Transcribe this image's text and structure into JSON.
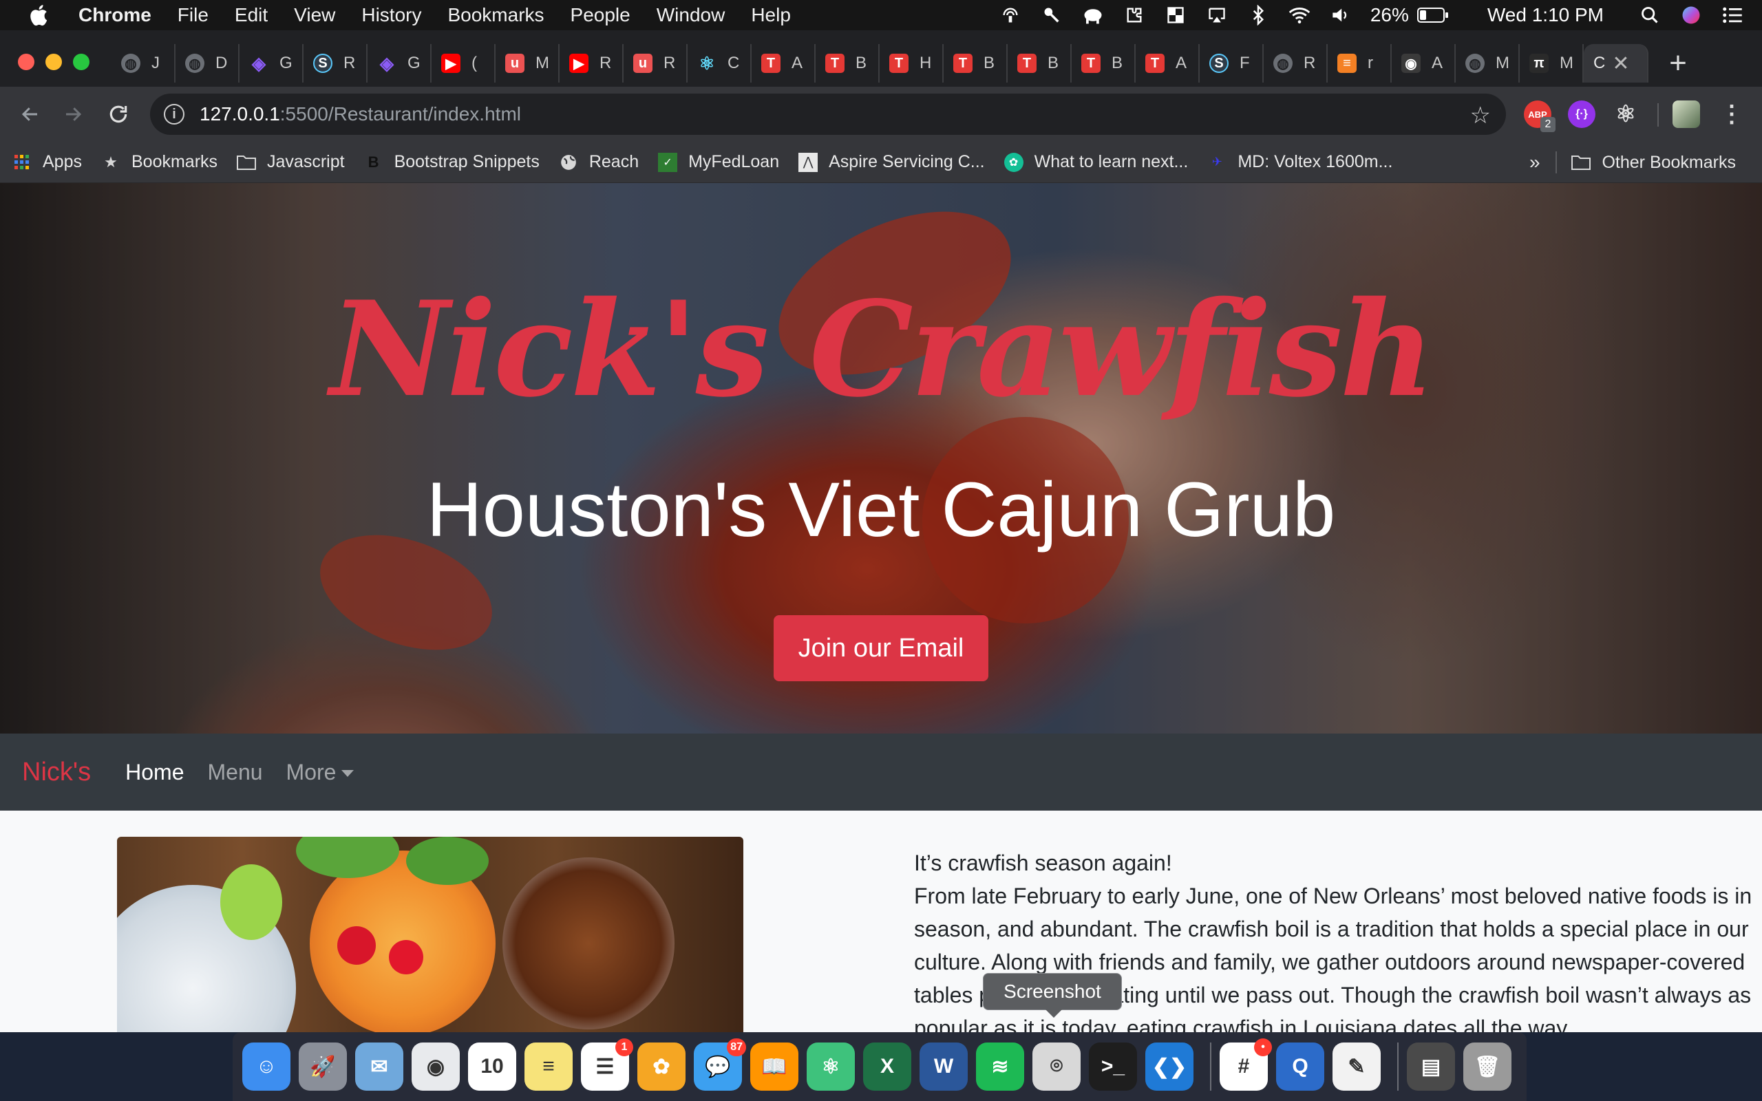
{
  "menubar": {
    "app_name": "Chrome",
    "items": [
      "File",
      "Edit",
      "View",
      "History",
      "Bookmarks",
      "People",
      "Window",
      "Help"
    ],
    "battery": "26%",
    "clock": "Wed 1:10 PM"
  },
  "browser": {
    "tabs": [
      {
        "label": "J",
        "icon": "globe-icon",
        "color": "#6b6f75"
      },
      {
        "label": "D",
        "icon": "globe-icon",
        "color": "#6b6f75"
      },
      {
        "label": "G",
        "icon": "graphql-icon",
        "color": "#8b5cf6"
      },
      {
        "label": "R",
        "icon": "s-logo-icon",
        "color": "#2f3b48"
      },
      {
        "label": "G",
        "icon": "graphql-icon",
        "color": "#8b5cf6"
      },
      {
        "label": "(",
        "icon": "youtube-icon",
        "color": "#ff0000"
      },
      {
        "label": "M",
        "icon": "udemy-icon",
        "color": "#ec5252"
      },
      {
        "label": "R",
        "icon": "youtube-icon",
        "color": "#ff0000"
      },
      {
        "label": "R",
        "icon": "udemy-icon",
        "color": "#ec5252"
      },
      {
        "label": "C",
        "icon": "react-icon",
        "color": "#61dafb"
      },
      {
        "label": "A",
        "icon": "t-logo-icon",
        "color": "#e53935"
      },
      {
        "label": "B",
        "icon": "t-logo-icon",
        "color": "#e53935"
      },
      {
        "label": "H",
        "icon": "t-logo-icon",
        "color": "#e53935"
      },
      {
        "label": "B",
        "icon": "t-logo-icon",
        "color": "#e53935"
      },
      {
        "label": "B",
        "icon": "t-logo-icon",
        "color": "#e53935"
      },
      {
        "label": "B",
        "icon": "t-logo-icon",
        "color": "#e53935"
      },
      {
        "label": "A",
        "icon": "t-logo-icon",
        "color": "#e53935"
      },
      {
        "label": "F",
        "icon": "s-logo-icon",
        "color": "#2f3b48"
      },
      {
        "label": "R",
        "icon": "globe-icon",
        "color": "#6b6f75"
      },
      {
        "label": "r",
        "icon": "stackoverflow-icon",
        "color": "#f48024"
      },
      {
        "label": "A",
        "icon": "github-icon",
        "color": "#3a3a3a"
      },
      {
        "label": "M",
        "icon": "globe-icon",
        "color": "#6b6f75"
      },
      {
        "label": "M",
        "icon": "pi-icon",
        "color": "#2a2a2a"
      }
    ],
    "active_tab": {
      "label": "C",
      "close": "✕"
    },
    "new_tab": "+",
    "url_host": "127.0.0.1",
    "url_path": ":5500/Restaurant/index.html",
    "ext_badge": "2",
    "bookmarks": [
      {
        "label": "Apps",
        "icon": "apps-grid-icon"
      },
      {
        "label": "Bookmarks",
        "icon": "star-icon"
      },
      {
        "label": "Javascript",
        "icon": "folder-icon"
      },
      {
        "label": "Bootstrap Snippets",
        "icon": "bootstrap-icon"
      },
      {
        "label": "Reach",
        "icon": "globe-icon"
      },
      {
        "label": "MyFedLoan",
        "icon": "myfedloan-icon"
      },
      {
        "label": "Aspire Servicing C...",
        "icon": "aspire-icon"
      },
      {
        "label": "What to learn next...",
        "icon": "khan-icon"
      },
      {
        "label": "MD: Voltex 1600m...",
        "icon": "md-icon"
      }
    ],
    "bookmarks_more": "»",
    "other_bookmarks": "Other Bookmarks"
  },
  "page": {
    "hero_title": "Nick's Crawfish",
    "hero_subtitle": "Houston's Viet Cajun Grub",
    "hero_button": "Join our Email",
    "nav": {
      "brand": "Nick's",
      "links": [
        "Home",
        "Menu",
        "More"
      ]
    },
    "content_heading": "It’s crawfish season again!",
    "content_body": "From late February to early June, one of New Orleans’ most beloved native foods is in season, and abundant. The crawfish boil is a tradition that holds a special place in our culture. Along with friends and family, we gather outdoors around newspaper-covered tables peeling and eating until we pass out. Though the crawfish boil wasn’t always as popular as it is today, eating crawfish in Louisiana dates all the way"
  },
  "dock": {
    "tooltip": "Screenshot",
    "apps": [
      {
        "name": "finder-icon",
        "color": "#3d8ef0",
        "glyph": "☺"
      },
      {
        "name": "launchpad-icon",
        "color": "#8a8f99",
        "glyph": "🚀"
      },
      {
        "name": "mail-icon",
        "color": "#6fa8dc",
        "glyph": "✉"
      },
      {
        "name": "chrome-icon",
        "color": "#e8eaed",
        "glyph": "◉"
      },
      {
        "name": "calendar-icon",
        "color": "#ffffff",
        "glyph": "10"
      },
      {
        "name": "notes-icon",
        "color": "#f7e37a",
        "glyph": "≡"
      },
      {
        "name": "reminders-icon",
        "color": "#ffffff",
        "glyph": "☰",
        "badge": "1"
      },
      {
        "name": "photos-icon",
        "color": "#f5a623",
        "glyph": "✿"
      },
      {
        "name": "messages-icon",
        "color": "#3ca0f0",
        "glyph": "💬",
        "badge": "87"
      },
      {
        "name": "books-icon",
        "color": "#ff9500",
        "glyph": "📖"
      },
      {
        "name": "atom-icon",
        "color": "#3ec27c",
        "glyph": "⚛"
      },
      {
        "name": "excel-icon",
        "color": "#1e7145",
        "glyph": "X"
      },
      {
        "name": "word-icon",
        "color": "#2b579a",
        "glyph": "W"
      },
      {
        "name": "spotify-icon",
        "color": "#1db954",
        "glyph": "≋"
      },
      {
        "name": "screenshot-icon",
        "color": "#d8d8d8",
        "glyph": "⌾"
      },
      {
        "name": "terminal-icon",
        "color": "#1e1e1e",
        "glyph": ">_"
      },
      {
        "name": "vscode-icon",
        "color": "#1f7ad6",
        "glyph": "❮❯"
      },
      {
        "sep": true
      },
      {
        "name": "slack-icon",
        "color": "#ffffff",
        "glyph": "#",
        "badge": "•"
      },
      {
        "name": "quicktime-icon",
        "color": "#2c6bc9",
        "glyph": "Q"
      },
      {
        "name": "textedit-icon",
        "color": "#f2f2f2",
        "glyph": "✎"
      },
      {
        "sep": true
      },
      {
        "name": "downloads-stack-icon",
        "color": "#4a4a4a",
        "glyph": "▤"
      },
      {
        "name": "trash-icon",
        "color": "#9a9a9a",
        "glyph": "🗑"
      }
    ]
  }
}
